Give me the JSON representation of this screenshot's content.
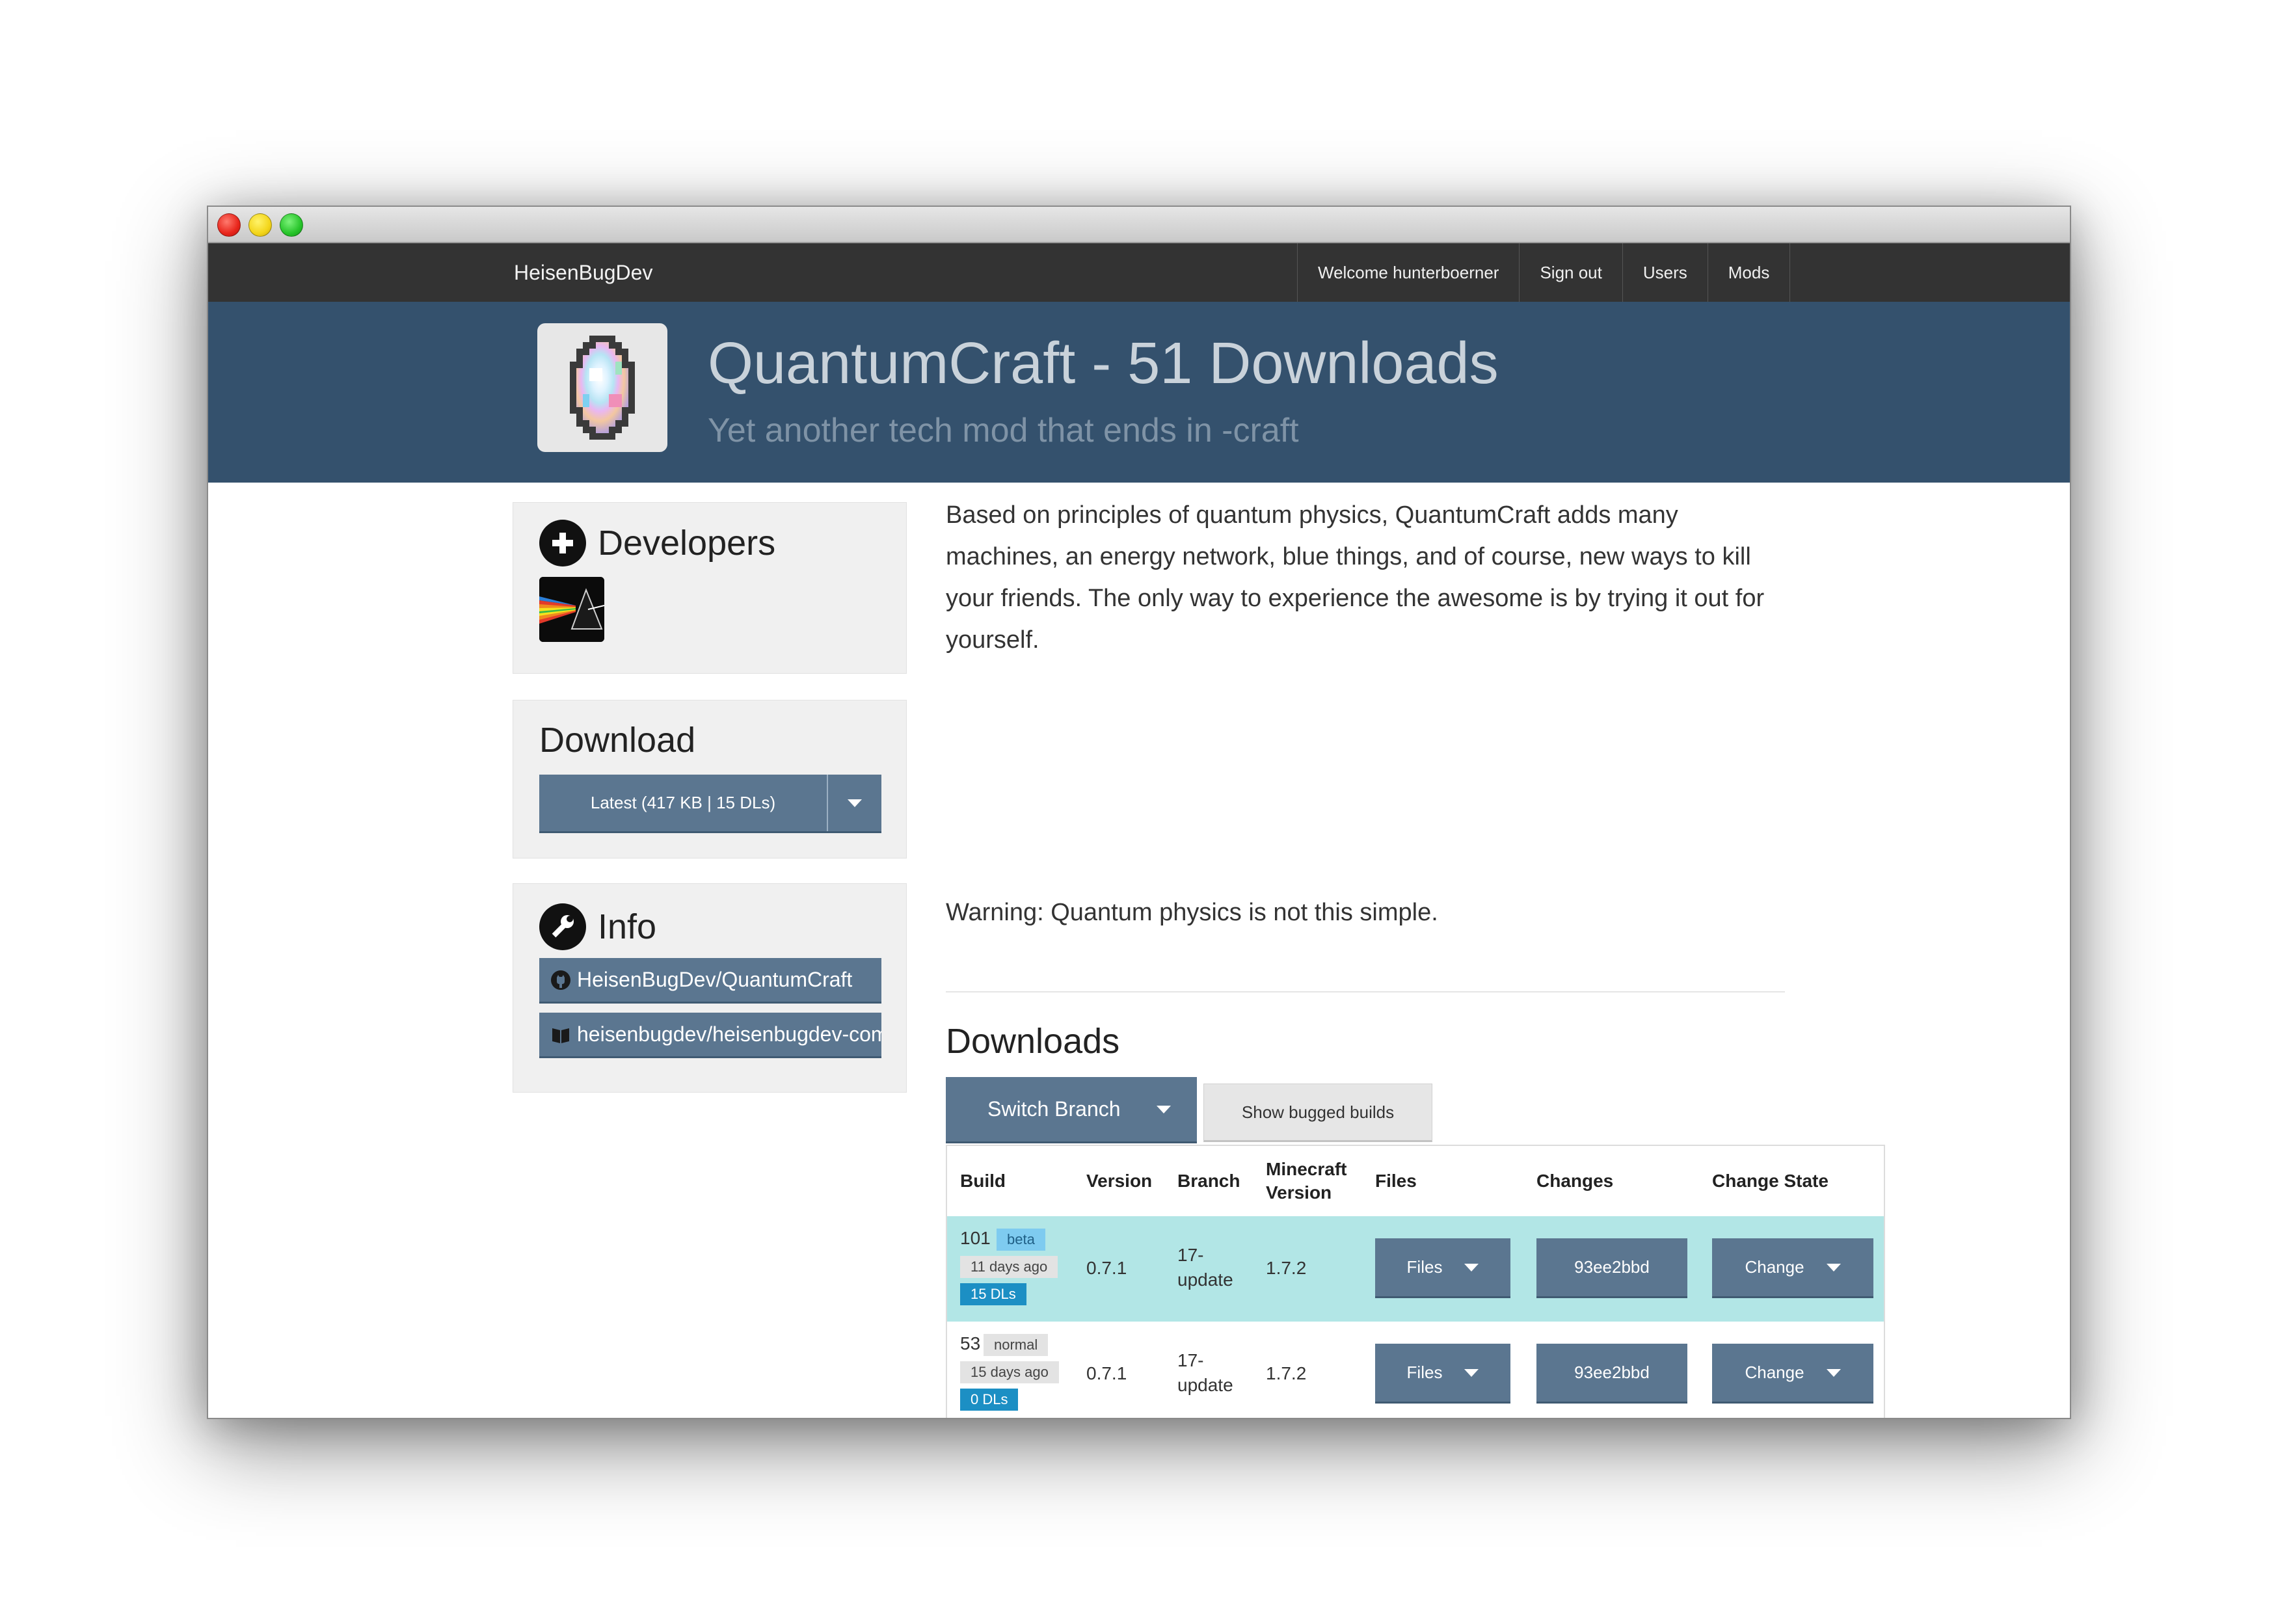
{
  "navbar": {
    "brand": "HeisenBugDev",
    "items": [
      "Welcome hunterboerner",
      "Sign out",
      "Users",
      "Mods"
    ]
  },
  "hero": {
    "title": "QuantumCraft - 51 Downloads",
    "subtitle": "Yet another tech mod that ends in -craft"
  },
  "sidebar": {
    "developers_heading": "Developers",
    "download_heading": "Download",
    "download_button": "Latest (417 KB | 15 DLs)",
    "info_heading": "Info",
    "links": [
      {
        "label": "HeisenBugDev/QuantumCraft",
        "icon": "github-icon"
      },
      {
        "label": "heisenbugdev/heisenbugdev-com",
        "icon": "book-icon"
      }
    ]
  },
  "description": {
    "text": "Based on principles of quantum physics, QuantumCraft adds many machines, an energy network, blue things, and of course, new ways to kill your friends. The only way to experience the awesome is by trying it out for yourself.",
    "warning": "Warning: Quantum physics is not this simple."
  },
  "downloads": {
    "heading": "Downloads",
    "switch_branch": "Switch Branch",
    "show_bugged": "Show bugged builds",
    "columns": {
      "build": "Build",
      "version": "Version",
      "branch": "Branch",
      "mc_line1": "Minecraft",
      "mc_line2": "Version",
      "files": "Files",
      "changes": "Changes",
      "change_state": "Change State"
    },
    "rows": [
      {
        "build": "101",
        "type": "beta",
        "ago": "11 days ago",
        "dls": "15 DLs",
        "version": "0.7.1",
        "branch_line1": "17-",
        "branch_line2": "update",
        "mc": "1.7.2",
        "files": "Files",
        "changes": "93ee2bbd",
        "change": "Change"
      },
      {
        "build": "53",
        "type": "normal",
        "ago": "15 days ago",
        "dls": "0 DLs",
        "version": "0.7.1",
        "branch_line1": "17-",
        "branch_line2": "update",
        "mc": "1.7.2",
        "files": "Files",
        "changes": "93ee2bbd",
        "change": "Change"
      }
    ]
  },
  "colors": {
    "navbar": "#333333",
    "hero": "#34516d",
    "button": "#5b7690",
    "highlight_row": "#b2e6e6",
    "dls_badge": "#1c8fc4",
    "beta_badge": "#7ecbf0"
  }
}
